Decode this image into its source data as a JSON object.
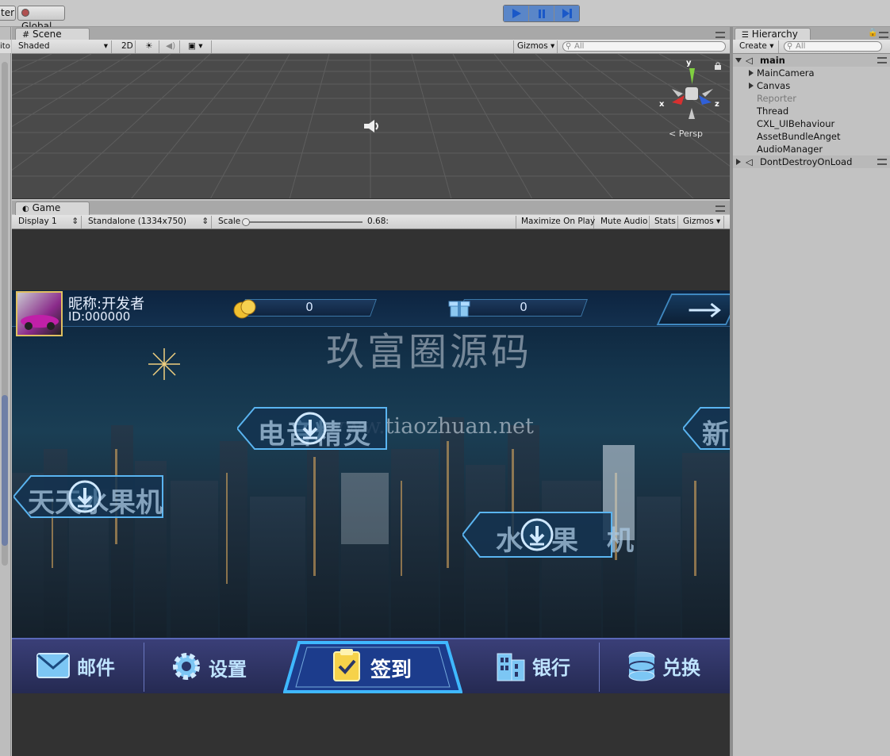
{
  "toolbar": {
    "left_label": "ter",
    "global_label": "Global"
  },
  "scene": {
    "tab": "Scene",
    "shading": "Shaded",
    "mode_2d": "2D",
    "gizmos": "Gizmos",
    "search_placeholder": "All",
    "axis_y": "y",
    "axis_x": "x",
    "axis_z": "z",
    "persp": "Persp",
    "left_cut": "ito"
  },
  "game": {
    "tab": "Game",
    "display": "Display 1",
    "resolution": "Standalone (1334x750)",
    "scale_label": "Scale",
    "scale_value": "0.68:",
    "maximize": "Maximize On Play",
    "mute": "Mute Audio",
    "stats": "Stats",
    "gizmos": "Gizmos"
  },
  "hierarchy": {
    "tab": "Hierarchy",
    "create": "Create",
    "search_placeholder": "All",
    "scene_name": "main",
    "items": [
      {
        "label": "MainCamera",
        "expandable": true,
        "gray": false
      },
      {
        "label": "Canvas",
        "expandable": true,
        "gray": false
      },
      {
        "label": "Reporter",
        "expandable": false,
        "gray": true
      },
      {
        "label": "Thread",
        "expandable": false,
        "gray": false
      },
      {
        "label": "CXL_UIBehaviour",
        "expandable": false,
        "gray": false
      },
      {
        "label": "AssetBundleAnget",
        "expandable": false,
        "gray": false
      },
      {
        "label": "AudioManager",
        "expandable": false,
        "gray": false
      }
    ],
    "ddol": "DontDestroyOnLoad"
  },
  "app": {
    "nickname": "昵称:开发者",
    "user_id": "ID:000000",
    "coins": "0",
    "gems": "0",
    "watermark_cn": "玖富圈源码",
    "watermark_url": "www.tiaozhuan.net",
    "games": [
      {
        "label": "电音精灵",
        "key": "game-dianyin"
      },
      {
        "label": "天天水果机",
        "key": "game-tiantian"
      },
      {
        "label": "水果机",
        "key": "game-shuiguo"
      },
      {
        "label": "新",
        "key": "game-new"
      }
    ],
    "bottom": {
      "mail": "邮件",
      "settings": "设置",
      "checkin": "签到",
      "bank": "银行",
      "exchange": "兑换"
    }
  },
  "colors": {
    "play_active": "#5a86c8",
    "top_bar": "#11263f",
    "bottom_bar": "#2c3566",
    "button_glow": "#3fb8ff",
    "coin_gold": "#f0c030"
  }
}
